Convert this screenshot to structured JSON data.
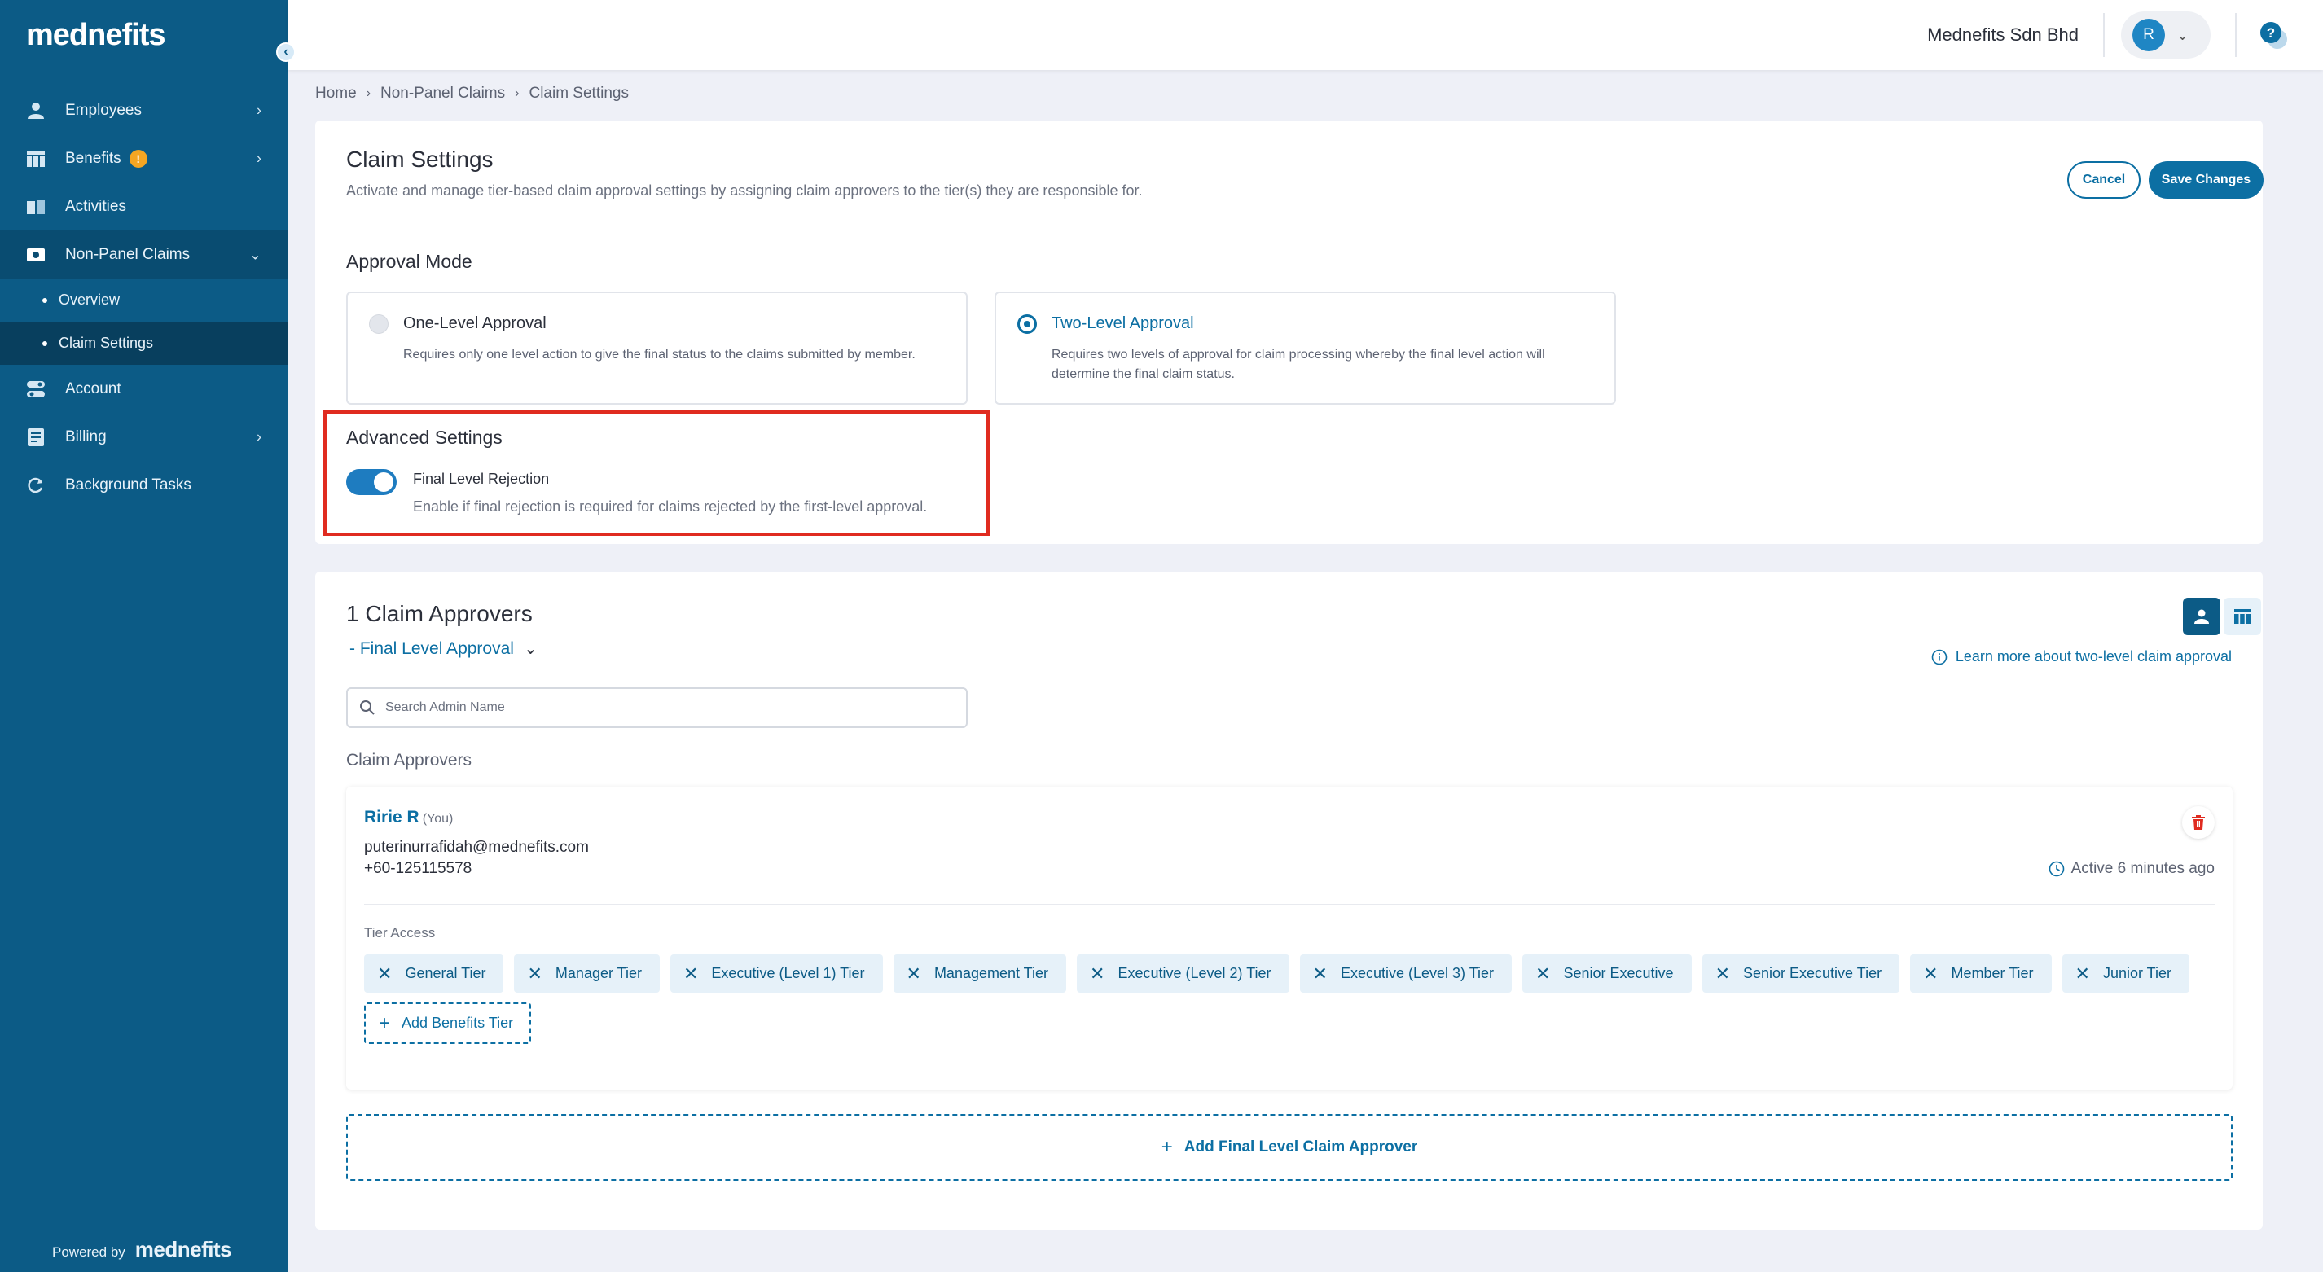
{
  "app": {
    "logo": "mednefits",
    "powered_by": "Powered by",
    "powered_logo": "mednefits"
  },
  "sidebar": {
    "items": [
      {
        "label": "Employees",
        "icon": "person-icon"
      },
      {
        "label": "Benefits",
        "icon": "grid-icon",
        "badge": "!"
      },
      {
        "label": "Activities",
        "icon": "book-icon"
      },
      {
        "label": "Non-Panel Claims",
        "icon": "cash-icon"
      },
      {
        "label": "Account",
        "icon": "toggle-icon"
      },
      {
        "label": "Billing",
        "icon": "receipt-icon"
      },
      {
        "label": "Background Tasks",
        "icon": "refresh-icon"
      }
    ],
    "sub_items": [
      {
        "label": "Overview"
      },
      {
        "label": "Claim Settings"
      }
    ]
  },
  "header": {
    "company": "Mednefits Sdn Bhd",
    "avatar_initial": "R"
  },
  "breadcrumb": [
    "Home",
    "Non-Panel Claims",
    "Claim Settings"
  ],
  "settings": {
    "title": "Claim Settings",
    "description": "Activate and manage tier-based claim approval settings by assigning claim approvers to the tier(s) they are responsible for.",
    "cancel_label": "Cancel",
    "save_label": "Save Changes",
    "approval_mode_label": "Approval Mode",
    "modes": [
      {
        "title": "One-Level Approval",
        "description": "Requires only one level action to give the final status to the claims submitted by member.",
        "selected": false
      },
      {
        "title": "Two-Level Approval",
        "description": "Requires two levels of approval for claim processing whereby the final level action will determine the final claim status.",
        "selected": true
      }
    ],
    "advanced": {
      "title": "Advanced Settings",
      "toggle_label": "Final Level Rejection",
      "toggle_desc": "Enable if final rejection is required for claims rejected by the first-level approval.",
      "enabled": true
    }
  },
  "approvers": {
    "title": "1 Claim Approvers",
    "level": "- Final Level Approval",
    "learn_more": "Learn more about two-level claim approval",
    "search_placeholder": "Search Admin Name",
    "subheading": "Claim Approvers",
    "list": [
      {
        "name": "Ririe R",
        "you": "(You)",
        "email": "puterinurrafidah@mednefits.com",
        "phone": "+60-125115578",
        "status": "Active 6 minutes ago",
        "tier_access_label": "Tier Access",
        "tiers": [
          "General Tier",
          "Manager Tier",
          "Executive (Level 1) Tier",
          "Management Tier",
          "Executive (Level 2) Tier",
          "Executive (Level 3) Tier",
          "Senior Executive",
          "Senior Executive Tier",
          "Member Tier",
          "Junior Tier"
        ],
        "add_tier_label": "Add Benefits Tier"
      }
    ],
    "add_approver_label": "Add Final Level Claim Approver"
  },
  "colors": {
    "sidebar": "#0c5b86",
    "accent": "#0c6fa3",
    "highlight_border": "#e02b20",
    "badge": "#f5a623"
  }
}
